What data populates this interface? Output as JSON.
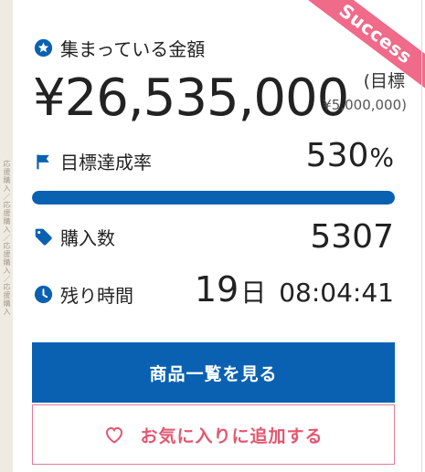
{
  "ribbon": {
    "label": "Success"
  },
  "raised": {
    "label": "集まっている金額",
    "amount": "¥26,535,000",
    "target_label": "(目標",
    "target_value": "¥5,000,000)"
  },
  "achievement": {
    "label": "目標達成率",
    "value": "530",
    "unit": "%",
    "progress_fraction": 1.0
  },
  "purchases": {
    "label": "購入数",
    "value": "5307"
  },
  "remaining": {
    "label": "残り時間",
    "days": "19",
    "day_unit": "日",
    "clock": "08:04:41"
  },
  "buttons": {
    "view_products": "商品一覧を見る",
    "add_favorite": "お気に入りに追加する"
  },
  "strip": {
    "text": "応援購入／応援購入／応援購入／応援購入"
  },
  "colors": {
    "accent": "#0a61b2",
    "ribbon": "#f06a8a",
    "favorite": "#e3576f"
  },
  "icons": {
    "raised": "star-circle-icon",
    "achievement": "flag-icon",
    "purchases": "tag-icon",
    "remaining": "clock-icon",
    "favorite": "heart-outline-icon"
  }
}
